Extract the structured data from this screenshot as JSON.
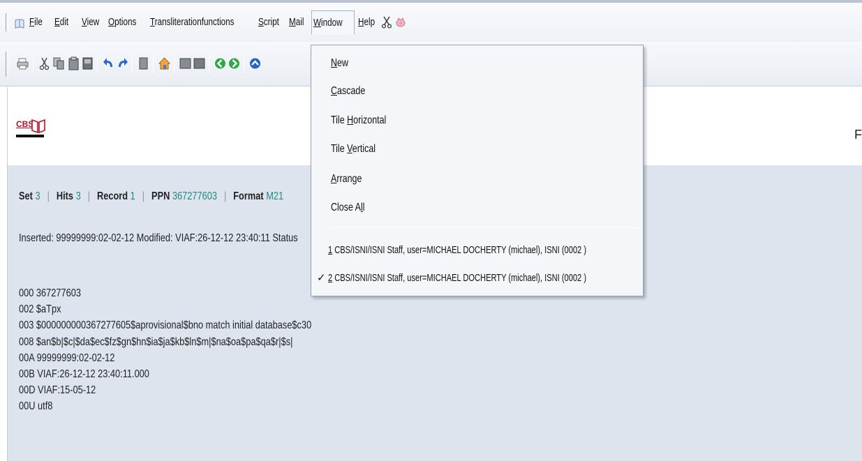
{
  "menu": {
    "items": [
      {
        "pre": "",
        "u": "F",
        "post": "ile"
      },
      {
        "pre": "",
        "u": "E",
        "post": "dit"
      },
      {
        "pre": "",
        "u": "V",
        "post": "iew"
      },
      {
        "pre": "",
        "u": "O",
        "post": "ptions"
      },
      {
        "pre": "",
        "u": "T",
        "post": "ransliterationfunctions"
      },
      {
        "pre": "",
        "u": "S",
        "post": "cript"
      },
      {
        "pre": "",
        "u": "M",
        "post": "ail"
      },
      {
        "pre": "",
        "u": "W",
        "post": "indow"
      },
      {
        "pre": "",
        "u": "H",
        "post": "elp"
      }
    ]
  },
  "icons": {
    "app": "book-icon",
    "scissors": "scissors-icon",
    "pig": "pig-icon",
    "toolbar": [
      "print-icon",
      "cut-icon",
      "copy-icon",
      "paste-icon",
      "save-icon",
      "undo-icon",
      "redo-icon",
      "new-doc-icon",
      "home-icon",
      "list-icon",
      "list2-icon",
      "back-icon",
      "forward-icon",
      "up-icon"
    ]
  },
  "window_menu": {
    "items": [
      {
        "pre": "",
        "u": "N",
        "post": "ew"
      },
      {
        "pre": "",
        "u": "C",
        "post": "ascade"
      },
      {
        "pre": "Tile ",
        "u": "H",
        "post": "orizontal"
      },
      {
        "pre": "Tile ",
        "u": "V",
        "post": "ertical"
      },
      {
        "pre": "",
        "u": "A",
        "post": "rrange"
      },
      {
        "pre": "Close A",
        "u": "l",
        "post": "l"
      }
    ],
    "windows": [
      {
        "u": "1",
        "post": " CBS/ISNI/ISNI Staff, user=MICHAEL DOCHERTY (michael), ISNI (0002 )",
        "checked": false
      },
      {
        "u": "2",
        "post": " CBS/ISNI/ISNI Staff, user=MICHAEL DOCHERTY (michael), ISNI (0002 )",
        "checked": true
      }
    ],
    "check_glyph": "✓"
  },
  "header": {
    "logo_text": "CBS",
    "right_letter": "F"
  },
  "record": {
    "set_label": "Set",
    "set_value": "3",
    "hits_label": "Hits",
    "hits_value": "3",
    "record_label": "Record",
    "record_value": "1",
    "ppn_label": "PPN",
    "ppn_value": "367277603",
    "format_label": "Format",
    "format_value": "M21",
    "separator": "|",
    "inserted": "Inserted: 99999999:02-02-12 Modified: VIAF:26-12-12 23:40:11 Status",
    "fields": [
      "000 367277603",
      "002 $aTpx",
      "003 $000000000367277605$aprovisional$bno match initial database$c30",
      "008 $an$b|$c|$da$ec$fz$gn$hn$ia$ja$kb$ln$m|$na$oa$pa$qa$r|$s|",
      "00A 99999999:02-02-12",
      "00B VIAF:26-12-12 23:40:11.000",
      "00D VIAF:15-05-12",
      "00U utf8"
    ]
  },
  "colors": {
    "accent_value": "#1f8a80",
    "logo_red": "#b8102a",
    "content_bg": "#dde4ee"
  }
}
